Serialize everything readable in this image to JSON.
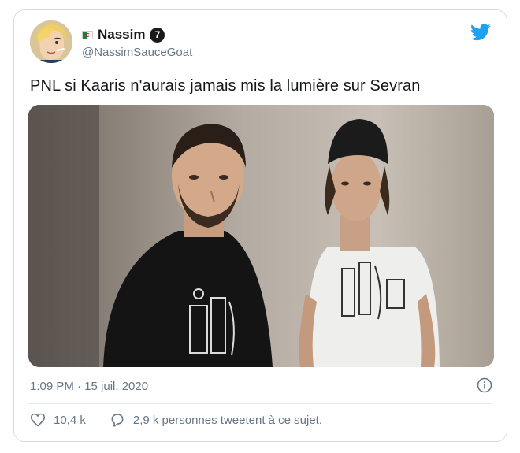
{
  "tweet": {
    "author": {
      "display_name": "Nassim",
      "handle": "@NassimSauceGoat",
      "badge_text": "7",
      "avatar_icon": "anime-character-avatar",
      "flag_icon": "algeria-flag-icon"
    },
    "text": "PNL si Kaaris n'aurais jamais mis la lumière sur Sevran",
    "timestamp": "1:09 PM · 15 juil. 2020",
    "likes": "10,4 k",
    "replies": "2,9 k personnes tweetent à ce sujet.",
    "brand_icon": "twitter-bird-icon",
    "colors": {
      "twitter_blue": "#1da1f2",
      "secondary_text": "#657786",
      "border": "#d6dde3"
    }
  }
}
